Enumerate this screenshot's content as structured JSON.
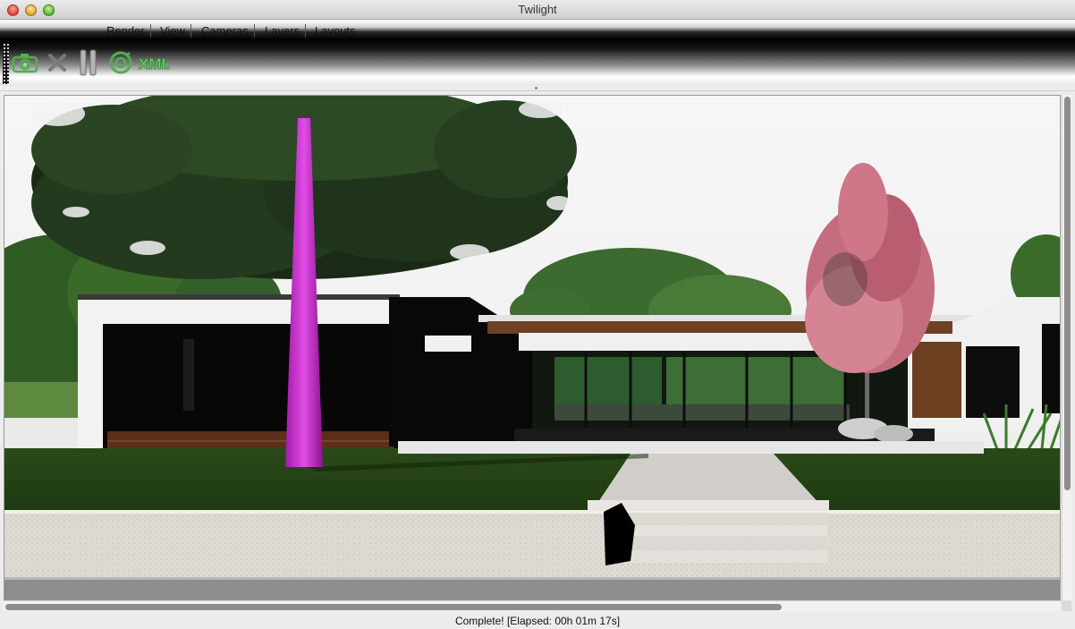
{
  "window": {
    "title": "Twilight"
  },
  "menubar": {
    "items": [
      {
        "label": "Render"
      },
      {
        "label": "View"
      },
      {
        "label": "Cameras"
      },
      {
        "label": "Layers"
      },
      {
        "label": "Layouts"
      }
    ]
  },
  "toolbar": {
    "buttons": [
      {
        "icon": "render-camera-icon"
      },
      {
        "icon": "stop-icon"
      },
      {
        "icon": "pause-icon"
      },
      {
        "icon": "refresh-icon"
      },
      {
        "icon": "xml-icon",
        "label": "XML"
      }
    ],
    "accent": "#4fb04c"
  },
  "statusbar": {
    "text": "Complete!  [Elapsed: 00h 01m 17s]"
  }
}
